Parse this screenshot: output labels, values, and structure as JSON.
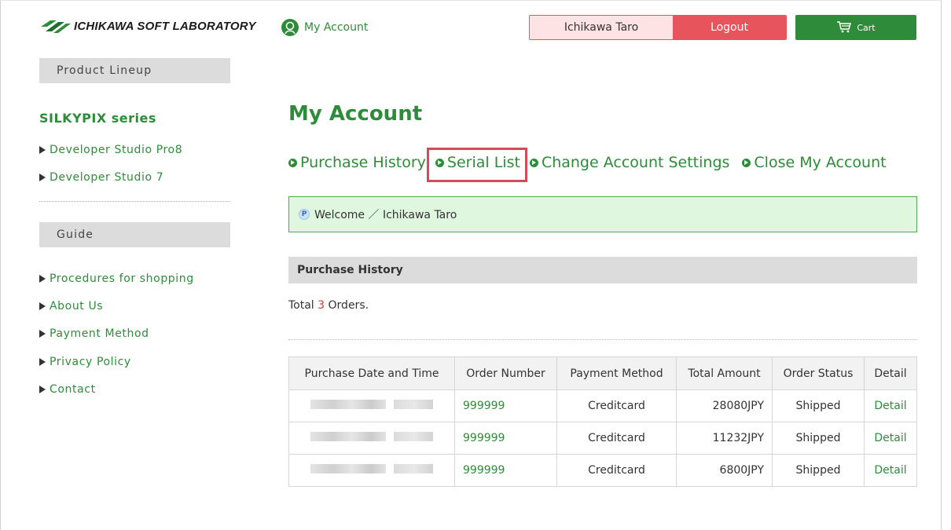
{
  "header": {
    "brand": "ICHIKAWA SOFT LABORATORY",
    "my_account_link": "My Account",
    "user_name": "Ichikawa Taro",
    "logout_label": "Logout",
    "cart_label": "Cart"
  },
  "sidebar": {
    "product_lineup_heading": "Product Lineup",
    "series_title": "SILKYPIX series",
    "products": [
      {
        "label": "Developer Studio Pro8"
      },
      {
        "label": "Developer Studio 7"
      }
    ],
    "guide_heading": "Guide",
    "guide_links": [
      {
        "label": "Procedures for shopping"
      },
      {
        "label": "About Us"
      },
      {
        "label": "Payment Method"
      },
      {
        "label": "Privacy Policy"
      },
      {
        "label": "Contact"
      }
    ]
  },
  "main": {
    "title": "My Account",
    "tabs": [
      {
        "label": "Purchase History"
      },
      {
        "label": "Serial List"
      },
      {
        "label": "Change Account Settings"
      },
      {
        "label": "Close My Account"
      }
    ],
    "welcome_text": "Welcome ／ Ichikawa Taro",
    "section_title": "Purchase History",
    "total_prefix": "Total ",
    "total_count": "3",
    "total_suffix": " Orders.",
    "table": {
      "headers": [
        "Purchase Date and Time",
        "Order Number",
        "Payment Method",
        "Total Amount",
        "Order Status",
        "Detail"
      ],
      "rows": [
        {
          "order_number": "999999",
          "payment": "Creditcard",
          "amount": "28080JPY",
          "status": "Shipped",
          "detail": "Detail"
        },
        {
          "order_number": "999999",
          "payment": "Creditcard",
          "amount": "11232JPY",
          "status": "Shipped",
          "detail": "Detail"
        },
        {
          "order_number": "999999",
          "payment": "Creditcard",
          "amount": "6800JPY",
          "status": "Shipped",
          "detail": "Detail"
        }
      ]
    }
  },
  "colors": {
    "brand_green": "#2e8b3a",
    "logout_red": "#e8545b",
    "highlight_red": "#d44b5a",
    "welcome_bg": "#dff7de"
  }
}
